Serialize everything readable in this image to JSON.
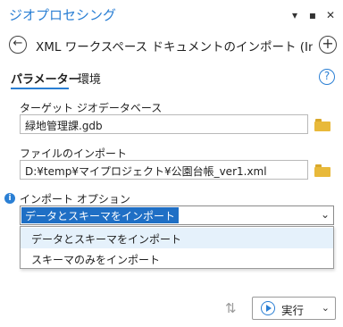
{
  "pane": {
    "title": "ジオプロセシング",
    "controls": {
      "menu": "▾",
      "maximize": "▪",
      "close": "✕"
    }
  },
  "tool": {
    "title": "XML ワークスペース ドキュメントのインポート (Im...",
    "back_icon": "back-arrow-icon",
    "add_icon": "add-icon"
  },
  "tabs": [
    {
      "label": "パラメーター",
      "active": true
    },
    {
      "label": "環境",
      "active": false
    }
  ],
  "help": {
    "glyph": "?"
  },
  "params": {
    "target_gdb": {
      "label": "ターゲット ジオデータベース",
      "value": "緑地管理課.gdb"
    },
    "import_file": {
      "label": "ファイルのインポート",
      "value": "D:¥temp¥マイプロジェクト¥公園台帳_ver1.xml"
    },
    "import_option": {
      "label": "インポート オプション",
      "info_glyph": "i",
      "selected": "データとスキーマをインポート",
      "options": [
        "データとスキーマをインポート",
        "スキーマのみをインポート"
      ]
    }
  },
  "footer": {
    "run_label": "実行",
    "dropdown_glyph": "⌄",
    "switch_icon_glyph": "⇅"
  },
  "colors": {
    "accent": "#2a7fd4",
    "selection": "#1f6fc5",
    "hover": "#e5f1fb",
    "folder": "#e8b93a"
  }
}
